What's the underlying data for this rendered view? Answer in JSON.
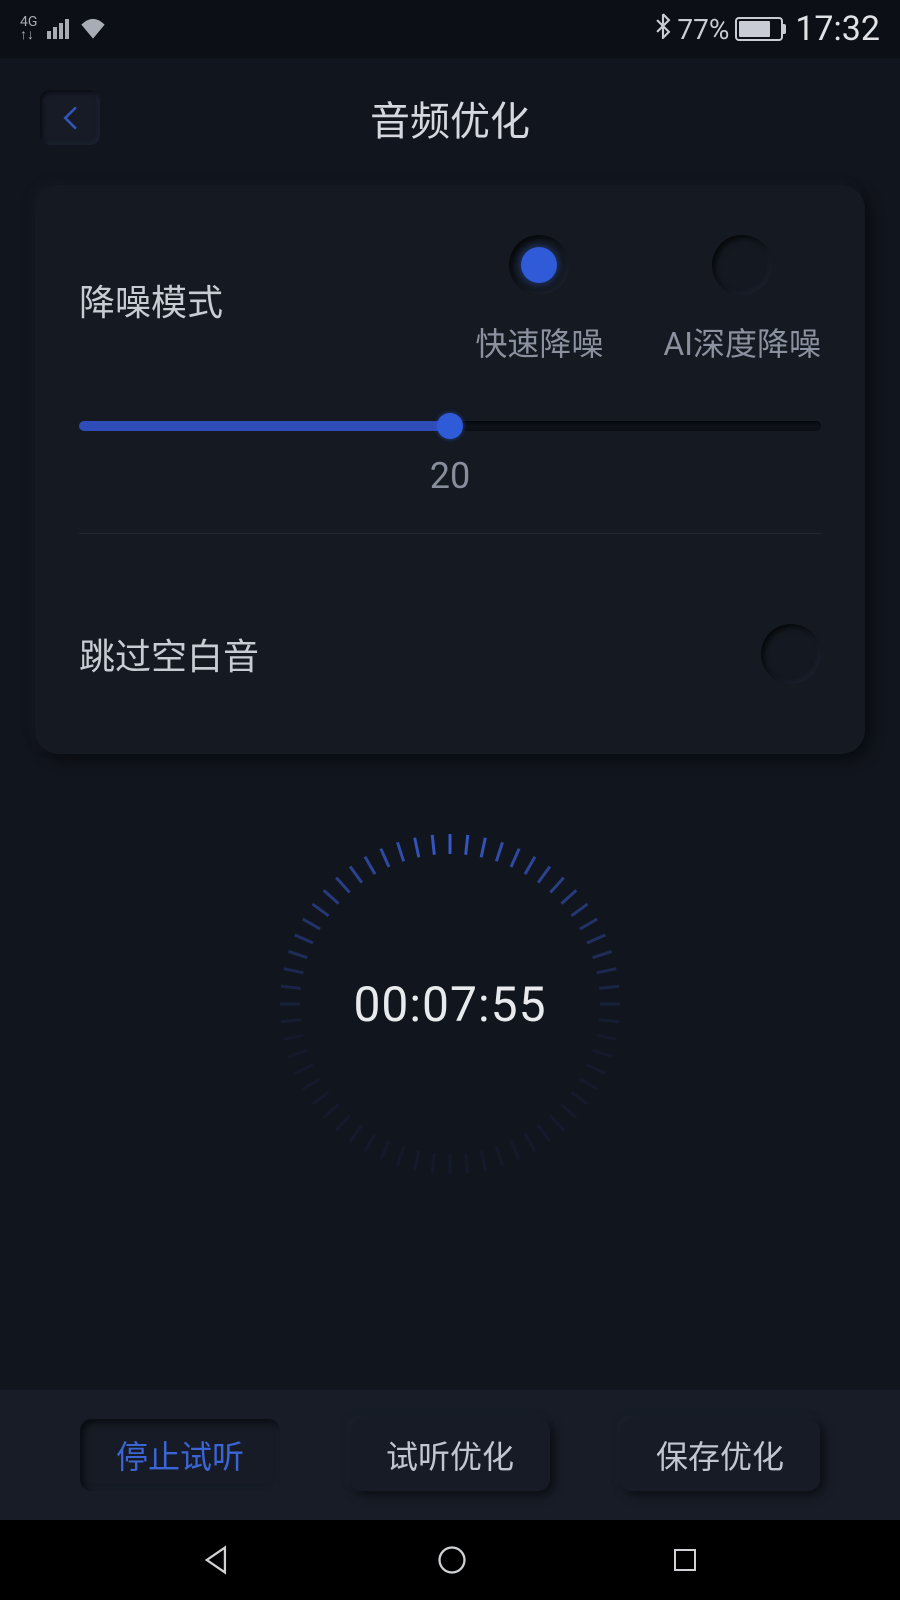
{
  "statusBar": {
    "network": "4G",
    "battery": "77%",
    "time": "17:32"
  },
  "header": {
    "title": "音频优化"
  },
  "noiseReduction": {
    "label": "降噪模式",
    "options": {
      "fast": "快速降噪",
      "ai": "AI深度降噪"
    },
    "sliderValue": "20"
  },
  "skipSilence": {
    "label": "跳过空白音"
  },
  "player": {
    "time": "00:07:55"
  },
  "actions": {
    "stop": "停止试听",
    "preview": "试听优化",
    "save": "保存优化"
  }
}
